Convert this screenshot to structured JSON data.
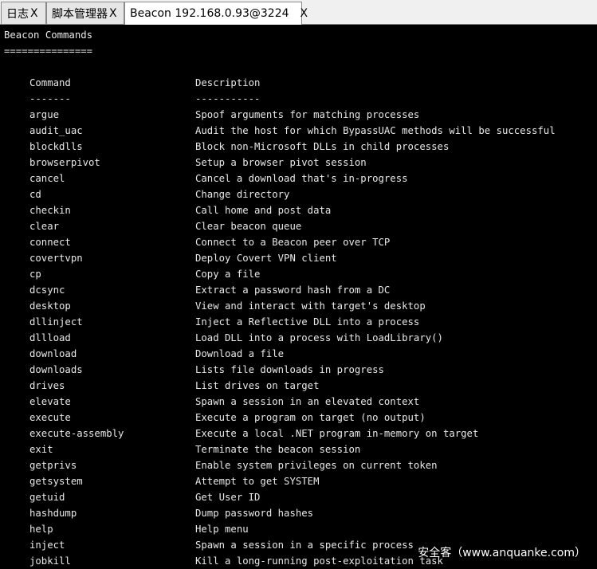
{
  "tabs": [
    {
      "label": "日志",
      "close": "X"
    },
    {
      "label": "脚本管理器",
      "close": "X"
    },
    {
      "label": "Beacon 192.168.0.93@3224",
      "close": "X"
    }
  ],
  "console": {
    "heading": "Beacon Commands",
    "underline": "===============",
    "col_command": "Command",
    "col_description": "Description",
    "col_command_rule": "-------",
    "col_description_rule": "-----------",
    "rows": [
      {
        "command": "argue",
        "description": "Spoof arguments for matching processes"
      },
      {
        "command": "audit_uac",
        "description": "Audit the host for which BypassUAC methods will be successful"
      },
      {
        "command": "blockdlls",
        "description": "Block non-Microsoft DLLs in child processes"
      },
      {
        "command": "browserpivot",
        "description": "Setup a browser pivot session"
      },
      {
        "command": "cancel",
        "description": "Cancel a download that's in-progress"
      },
      {
        "command": "cd",
        "description": "Change directory"
      },
      {
        "command": "checkin",
        "description": "Call home and post data"
      },
      {
        "command": "clear",
        "description": "Clear beacon queue"
      },
      {
        "command": "connect",
        "description": "Connect to a Beacon peer over TCP"
      },
      {
        "command": "covertvpn",
        "description": "Deploy Covert VPN client"
      },
      {
        "command": "cp",
        "description": "Copy a file"
      },
      {
        "command": "dcsync",
        "description": "Extract a password hash from a DC"
      },
      {
        "command": "desktop",
        "description": "View and interact with target's desktop"
      },
      {
        "command": "dllinject",
        "description": "Inject a Reflective DLL into a process"
      },
      {
        "command": "dllload",
        "description": "Load DLL into a process with LoadLibrary()"
      },
      {
        "command": "download",
        "description": "Download a file"
      },
      {
        "command": "downloads",
        "description": "Lists file downloads in progress"
      },
      {
        "command": "drives",
        "description": "List drives on target"
      },
      {
        "command": "elevate",
        "description": "Spawn a session in an elevated context"
      },
      {
        "command": "execute",
        "description": "Execute a program on target (no output)"
      },
      {
        "command": "execute-assembly",
        "description": "Execute a local .NET program in-memory on target"
      },
      {
        "command": "exit",
        "description": "Terminate the beacon session"
      },
      {
        "command": "getprivs",
        "description": "Enable system privileges on current token"
      },
      {
        "command": "getsystem",
        "description": "Attempt to get SYSTEM"
      },
      {
        "command": "getuid",
        "description": "Get User ID"
      },
      {
        "command": "hashdump",
        "description": "Dump password hashes"
      },
      {
        "command": "help",
        "description": "Help menu"
      },
      {
        "command": "inject",
        "description": "Spawn a session in a specific process"
      },
      {
        "command": "jobkill",
        "description": "Kill a long-running post-exploitation task"
      }
    ]
  },
  "watermark": "安全客（www.anquanke.com）",
  "colors": {
    "console_background": "#000000",
    "console_text": "#e8e8e8",
    "tabbar_background": "#f0f0f0",
    "active_tab_background": "#ffffff"
  }
}
